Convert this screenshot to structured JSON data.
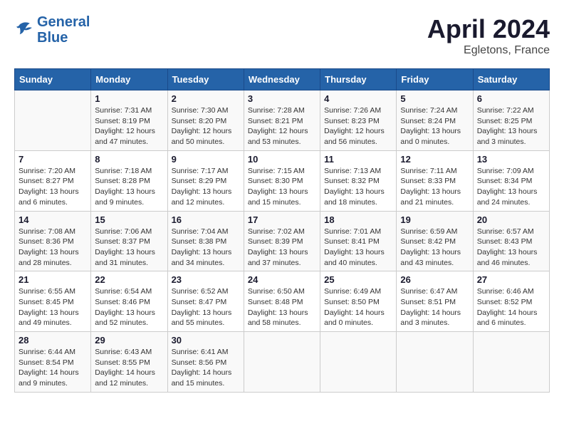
{
  "header": {
    "logo_line1": "General",
    "logo_line2": "Blue",
    "month_year": "April 2024",
    "location": "Egletons, France"
  },
  "weekdays": [
    "Sunday",
    "Monday",
    "Tuesday",
    "Wednesday",
    "Thursday",
    "Friday",
    "Saturday"
  ],
  "weeks": [
    [
      {
        "day": "",
        "info": ""
      },
      {
        "day": "1",
        "info": "Sunrise: 7:31 AM\nSunset: 8:19 PM\nDaylight: 12 hours\nand 47 minutes."
      },
      {
        "day": "2",
        "info": "Sunrise: 7:30 AM\nSunset: 8:20 PM\nDaylight: 12 hours\nand 50 minutes."
      },
      {
        "day": "3",
        "info": "Sunrise: 7:28 AM\nSunset: 8:21 PM\nDaylight: 12 hours\nand 53 minutes."
      },
      {
        "day": "4",
        "info": "Sunrise: 7:26 AM\nSunset: 8:23 PM\nDaylight: 12 hours\nand 56 minutes."
      },
      {
        "day": "5",
        "info": "Sunrise: 7:24 AM\nSunset: 8:24 PM\nDaylight: 13 hours\nand 0 minutes."
      },
      {
        "day": "6",
        "info": "Sunrise: 7:22 AM\nSunset: 8:25 PM\nDaylight: 13 hours\nand 3 minutes."
      }
    ],
    [
      {
        "day": "7",
        "info": "Sunrise: 7:20 AM\nSunset: 8:27 PM\nDaylight: 13 hours\nand 6 minutes."
      },
      {
        "day": "8",
        "info": "Sunrise: 7:18 AM\nSunset: 8:28 PM\nDaylight: 13 hours\nand 9 minutes."
      },
      {
        "day": "9",
        "info": "Sunrise: 7:17 AM\nSunset: 8:29 PM\nDaylight: 13 hours\nand 12 minutes."
      },
      {
        "day": "10",
        "info": "Sunrise: 7:15 AM\nSunset: 8:30 PM\nDaylight: 13 hours\nand 15 minutes."
      },
      {
        "day": "11",
        "info": "Sunrise: 7:13 AM\nSunset: 8:32 PM\nDaylight: 13 hours\nand 18 minutes."
      },
      {
        "day": "12",
        "info": "Sunrise: 7:11 AM\nSunset: 8:33 PM\nDaylight: 13 hours\nand 21 minutes."
      },
      {
        "day": "13",
        "info": "Sunrise: 7:09 AM\nSunset: 8:34 PM\nDaylight: 13 hours\nand 24 minutes."
      }
    ],
    [
      {
        "day": "14",
        "info": "Sunrise: 7:08 AM\nSunset: 8:36 PM\nDaylight: 13 hours\nand 28 minutes."
      },
      {
        "day": "15",
        "info": "Sunrise: 7:06 AM\nSunset: 8:37 PM\nDaylight: 13 hours\nand 31 minutes."
      },
      {
        "day": "16",
        "info": "Sunrise: 7:04 AM\nSunset: 8:38 PM\nDaylight: 13 hours\nand 34 minutes."
      },
      {
        "day": "17",
        "info": "Sunrise: 7:02 AM\nSunset: 8:39 PM\nDaylight: 13 hours\nand 37 minutes."
      },
      {
        "day": "18",
        "info": "Sunrise: 7:01 AM\nSunset: 8:41 PM\nDaylight: 13 hours\nand 40 minutes."
      },
      {
        "day": "19",
        "info": "Sunrise: 6:59 AM\nSunset: 8:42 PM\nDaylight: 13 hours\nand 43 minutes."
      },
      {
        "day": "20",
        "info": "Sunrise: 6:57 AM\nSunset: 8:43 PM\nDaylight: 13 hours\nand 46 minutes."
      }
    ],
    [
      {
        "day": "21",
        "info": "Sunrise: 6:55 AM\nSunset: 8:45 PM\nDaylight: 13 hours\nand 49 minutes."
      },
      {
        "day": "22",
        "info": "Sunrise: 6:54 AM\nSunset: 8:46 PM\nDaylight: 13 hours\nand 52 minutes."
      },
      {
        "day": "23",
        "info": "Sunrise: 6:52 AM\nSunset: 8:47 PM\nDaylight: 13 hours\nand 55 minutes."
      },
      {
        "day": "24",
        "info": "Sunrise: 6:50 AM\nSunset: 8:48 PM\nDaylight: 13 hours\nand 58 minutes."
      },
      {
        "day": "25",
        "info": "Sunrise: 6:49 AM\nSunset: 8:50 PM\nDaylight: 14 hours\nand 0 minutes."
      },
      {
        "day": "26",
        "info": "Sunrise: 6:47 AM\nSunset: 8:51 PM\nDaylight: 14 hours\nand 3 minutes."
      },
      {
        "day": "27",
        "info": "Sunrise: 6:46 AM\nSunset: 8:52 PM\nDaylight: 14 hours\nand 6 minutes."
      }
    ],
    [
      {
        "day": "28",
        "info": "Sunrise: 6:44 AM\nSunset: 8:54 PM\nDaylight: 14 hours\nand 9 minutes."
      },
      {
        "day": "29",
        "info": "Sunrise: 6:43 AM\nSunset: 8:55 PM\nDaylight: 14 hours\nand 12 minutes."
      },
      {
        "day": "30",
        "info": "Sunrise: 6:41 AM\nSunset: 8:56 PM\nDaylight: 14 hours\nand 15 minutes."
      },
      {
        "day": "",
        "info": ""
      },
      {
        "day": "",
        "info": ""
      },
      {
        "day": "",
        "info": ""
      },
      {
        "day": "",
        "info": ""
      }
    ]
  ]
}
